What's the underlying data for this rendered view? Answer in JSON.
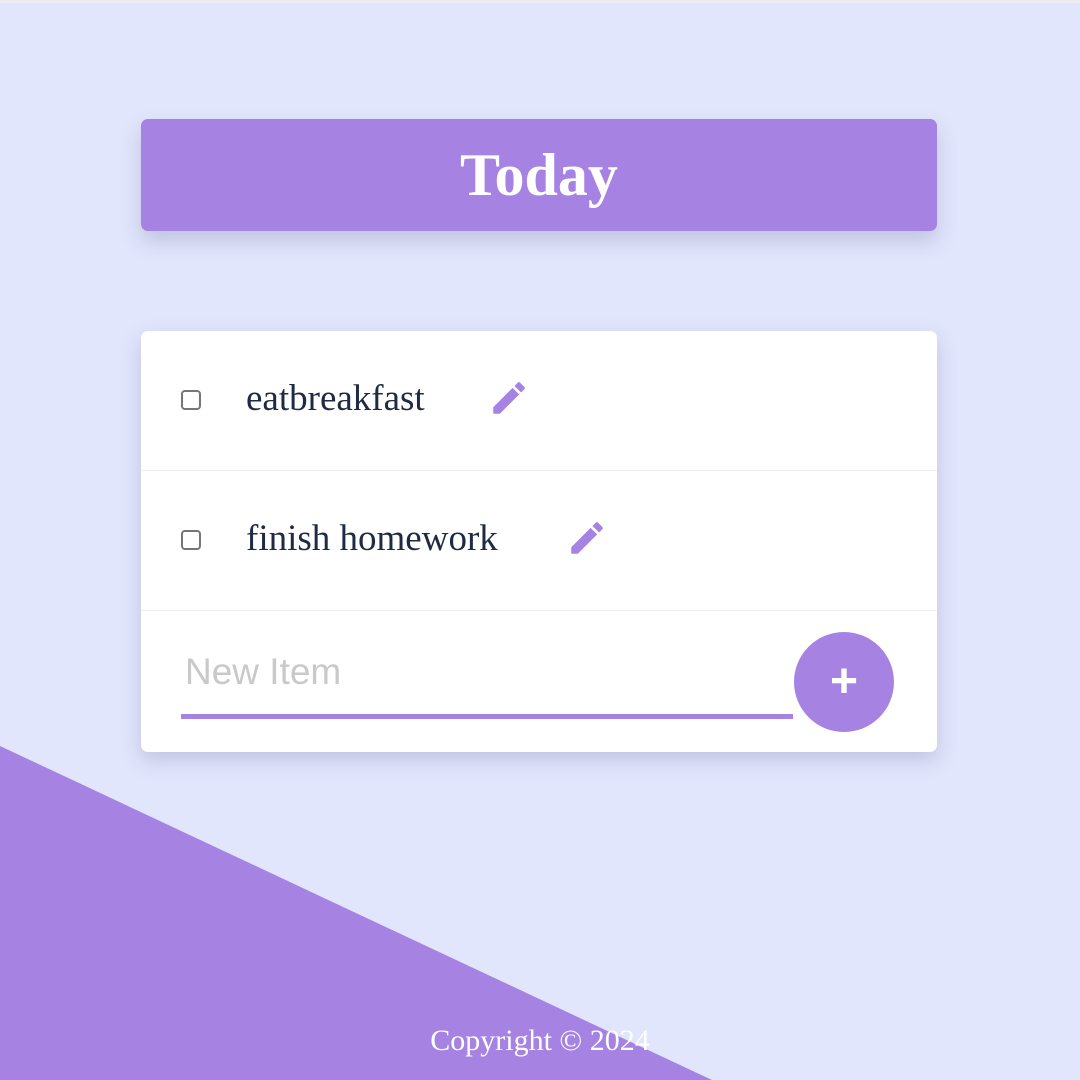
{
  "header": {
    "title": "Today"
  },
  "list": {
    "items": [
      {
        "label": "eatbreakfast",
        "checked": false,
        "icon": "pencil-icon"
      },
      {
        "label": "finish homework",
        "checked": false,
        "icon": "pencil-icon"
      }
    ],
    "new_item": {
      "placeholder": "New Item",
      "value": "",
      "add_label": "+"
    }
  },
  "footer": {
    "copyright": "Copyright © 2024"
  },
  "colors": {
    "accent": "#a683e3",
    "background": "#e1e6fc",
    "text": "#1f2a44"
  }
}
